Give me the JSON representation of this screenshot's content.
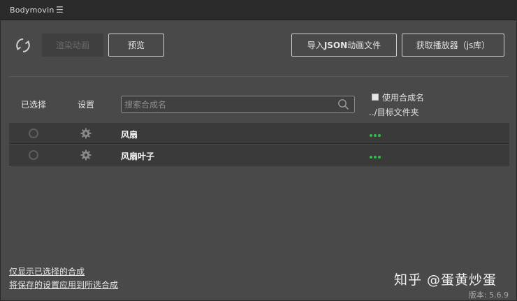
{
  "app": {
    "title": "Bodymovin",
    "menu_icon": "☰"
  },
  "toolbar": {
    "render_label": "渲染动画",
    "preview_label": "预览",
    "import_json_prefix": "导入 ",
    "import_json_bold": "JSON",
    "import_json_suffix": " 动画文件",
    "get_player_label": "获取播放器（js库）"
  },
  "list": {
    "col_selected": "已选择",
    "col_settings": "设置",
    "search_placeholder": "搜索合成名",
    "use_comp_name_label": "使用合成名",
    "dest_folder_label": "../目标文件夹",
    "items": [
      {
        "name": "风扇"
      },
      {
        "name": "风扇叶子"
      }
    ]
  },
  "footer": {
    "show_selected_link": "仅显示已选择的合成",
    "apply_settings_link": "将保存的设置应用到所选合成",
    "watermark": "知乎 @蛋黄炒蛋",
    "version": "版本: 5.6.9"
  },
  "colors": {
    "accent_green": "#2fbd4a",
    "panel": "#494949",
    "row": "#3a3a3a"
  }
}
